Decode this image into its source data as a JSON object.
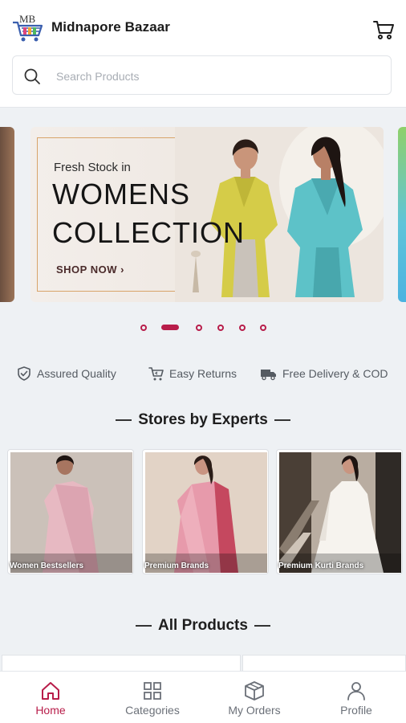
{
  "app": {
    "logo_text": "MB",
    "title": "Midnapore Bazaar"
  },
  "search": {
    "placeholder": "Search Products",
    "value": ""
  },
  "banner": {
    "line_small": "Fresh Stock in",
    "line_big_1": "WOMENS",
    "line_big_2": "COLLECTION",
    "cta": "SHOP NOW ›",
    "slide_count": 6,
    "active_slide": 2
  },
  "features": [
    {
      "icon": "shield-check-icon",
      "label": "Assured Quality"
    },
    {
      "icon": "cart-return-icon",
      "label": "Easy Returns"
    },
    {
      "icon": "truck-icon",
      "label": "Free Delivery & COD"
    }
  ],
  "stores_section": {
    "title": "Stores by Experts",
    "stores": [
      {
        "label": "Women Bestsellers"
      },
      {
        "label": "Premium Brands"
      },
      {
        "label": "Premium Kurti Brands"
      }
    ]
  },
  "products_section": {
    "title": "All Products"
  },
  "bottom_nav": [
    {
      "icon": "home-icon",
      "label": "Home",
      "active": true
    },
    {
      "icon": "categories-grid-icon",
      "label": "Categories",
      "active": false
    },
    {
      "icon": "orders-box-icon",
      "label": "My Orders",
      "active": false
    },
    {
      "icon": "profile-icon",
      "label": "Profile",
      "active": false
    }
  ],
  "colors": {
    "accent": "#b81d4a",
    "background": "#eef1f4",
    "banner_border": "#d8a46a"
  }
}
